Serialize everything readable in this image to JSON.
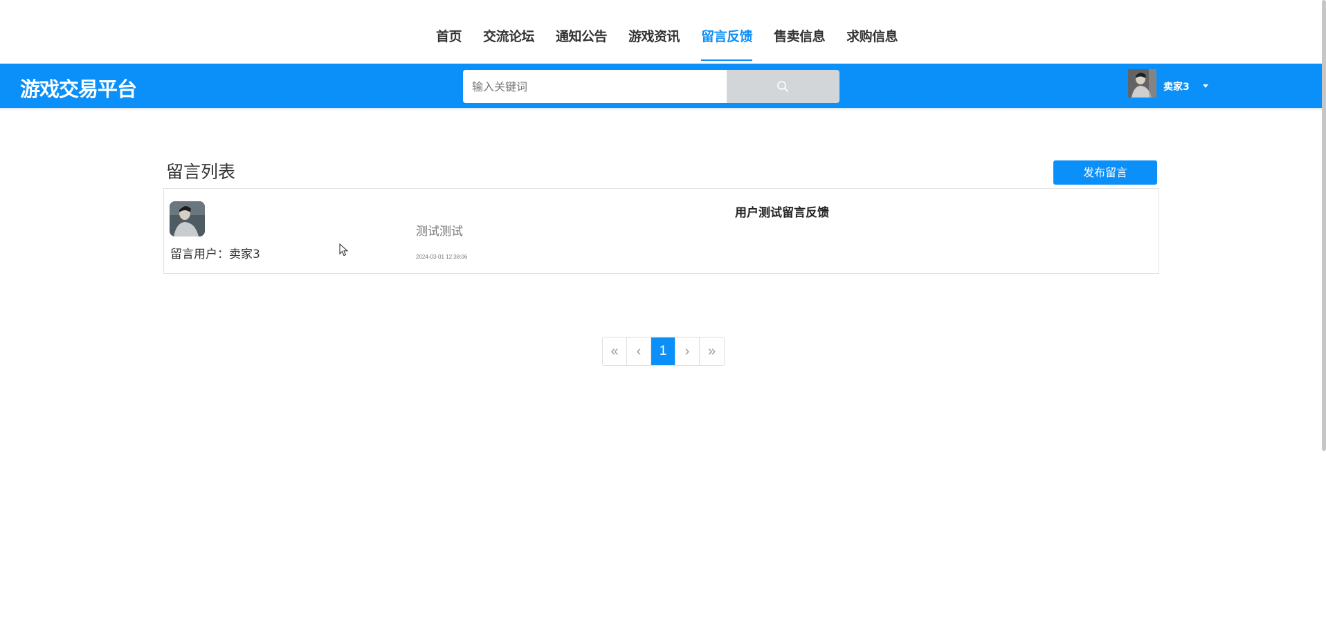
{
  "nav": {
    "items": [
      {
        "label": "首页",
        "active": false
      },
      {
        "label": "交流论坛",
        "active": false
      },
      {
        "label": "通知公告",
        "active": false
      },
      {
        "label": "游戏资讯",
        "active": false
      },
      {
        "label": "留言反馈",
        "active": true
      },
      {
        "label": "售卖信息",
        "active": false
      },
      {
        "label": "求购信息",
        "active": false
      }
    ]
  },
  "header": {
    "logo": "游戏交易平台",
    "search_placeholder": "输入关键词",
    "search_icon": "search-icon",
    "user_name": "卖家3"
  },
  "main": {
    "list_title": "留言列表",
    "publish_label": "发布留言",
    "messages": [
      {
        "user_label": "留言用户：卖家3",
        "title": "用户测试留言反馈",
        "content": "测试测试",
        "time": "2024-03-01 12:38:06"
      }
    ]
  },
  "pagination": {
    "first": "«",
    "prev": "‹",
    "current": "1",
    "next": "›",
    "last": "»"
  },
  "colors": {
    "brand": "#0b8ff8",
    "active_nav": "#0d8ef5",
    "search_button": "#d3d6d9"
  }
}
